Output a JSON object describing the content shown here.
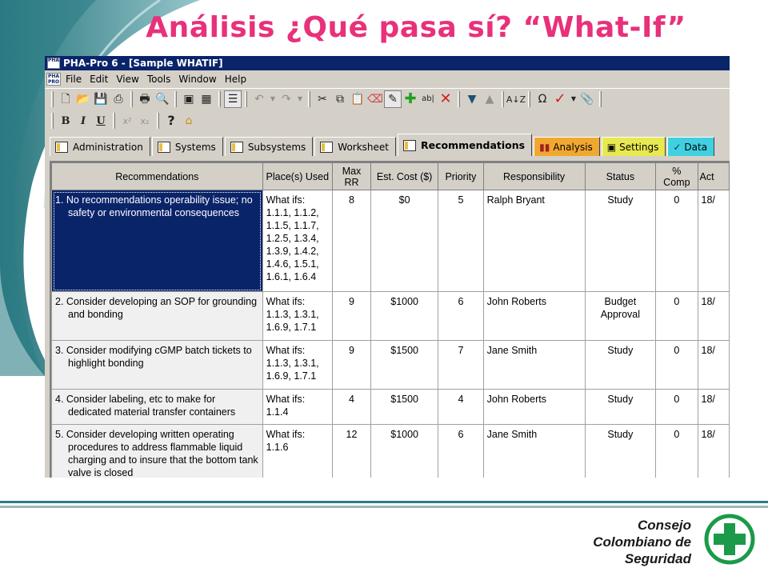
{
  "slide": {
    "title": "Análisis ¿Qué pasa sí? “What-If”",
    "logo_lines": [
      "Consejo",
      "Colombiano de",
      "Seguridad"
    ],
    "colors": {
      "title": "#e8317a",
      "teal": "#2c7d86",
      "logo_green": "#1b9a4a"
    }
  },
  "window": {
    "title": "PHA-Pro 6 - [Sample WHATIF]",
    "app_icon": "PHA PRO",
    "menu": [
      "File",
      "Edit",
      "View",
      "Tools",
      "Window",
      "Help"
    ]
  },
  "toolbar1_icons": [
    "new-file-icon",
    "open-folder-icon",
    "save-icon",
    "print-preview-icon",
    "print-icon",
    "page-preview-icon",
    "properties-icon",
    "grid-icon",
    "view-icon",
    "undo-icon",
    "redo-icon",
    "cut-icon",
    "copy-icon",
    "paste-icon",
    "eraser-icon",
    "highlight-icon",
    "add-icon",
    "rename-icon",
    "delete-icon",
    "move-down-icon",
    "move-up-icon",
    "sort-icon",
    "omega-icon",
    "check-icon",
    "attach-icon"
  ],
  "toolbar2": {
    "bold": "B",
    "italic": "I",
    "underline": "U",
    "superscript": "x²",
    "subscript": "x₂"
  },
  "tabs": [
    {
      "label": "Administration",
      "style": ""
    },
    {
      "label": "Systems",
      "style": ""
    },
    {
      "label": "Subsystems",
      "style": ""
    },
    {
      "label": "Worksheet",
      "style": ""
    },
    {
      "label": "Recommendations",
      "style": "active"
    },
    {
      "label": "Analysis",
      "style": "analysis"
    },
    {
      "label": "Settings",
      "style": "settings"
    },
    {
      "label": "Data",
      "style": "data"
    }
  ],
  "table": {
    "headers": [
      "Recommendations",
      "Place(s) Used",
      "Max RR",
      "Est. Cost ($)",
      "Priority",
      "Responsibility",
      "Status",
      "% Comp",
      "Act"
    ],
    "rows": [
      {
        "rec": "1. No recommendations operability issue; no safety or environmental consequences",
        "places": "What ifs: 1.1.1, 1.1.2, 1.1.5, 1.1.7, 1.2.5, 1.3.4, 1.3.9, 1.4.2, 1.4.6, 1.5.1, 1.6.1, 1.6.4",
        "max_rr": "8",
        "cost": "$0",
        "priority": "5",
        "responsibility": "Ralph Bryant",
        "status": "Study",
        "comp": "0",
        "act": "18/"
      },
      {
        "rec": "2. Consider developing an SOP for grounding and bonding",
        "places": "What ifs: 1.1.3, 1.3.1, 1.6.9, 1.7.1",
        "max_rr": "9",
        "cost": "$1000",
        "priority": "6",
        "responsibility": "John Roberts",
        "status": "Budget Approval",
        "comp": "0",
        "act": "18/"
      },
      {
        "rec": "3. Consider modifying cGMP batch tickets to highlight bonding",
        "places": "What ifs: 1.1.3, 1.3.1, 1.6.9, 1.7.1",
        "max_rr": "9",
        "cost": "$1500",
        "priority": "7",
        "responsibility": "Jane Smith",
        "status": "Study",
        "comp": "0",
        "act": "18/"
      },
      {
        "rec": "4. Consider labeling, etc to make for dedicated material transfer containers",
        "places": "What ifs: 1.1.4",
        "max_rr": "4",
        "cost": "$1500",
        "priority": "4",
        "responsibility": "John Roberts",
        "status": "Study",
        "comp": "0",
        "act": "18/"
      },
      {
        "rec": "5. Consider developing written operating procedures to address flammable liquid charging and to insure that the bottom tank valve is closed",
        "places": "What ifs: 1.1.6",
        "max_rr": "12",
        "cost": "$1000",
        "priority": "6",
        "responsibility": "Jane Smith",
        "status": "Study",
        "comp": "0",
        "act": "18/"
      }
    ]
  }
}
